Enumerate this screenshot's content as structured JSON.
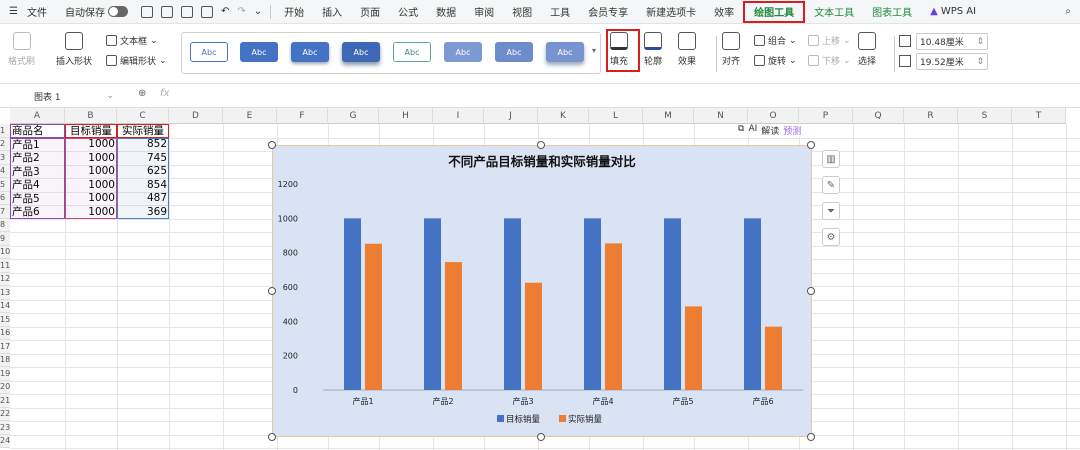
{
  "menubar": {
    "file": "文件",
    "autosave": "自动保存",
    "tabs": [
      "开始",
      "插入",
      "页面",
      "公式",
      "数据",
      "审阅",
      "视图",
      "工具",
      "会员专享",
      "新建选项卡",
      "效率",
      "绘图工具",
      "文本工具",
      "图表工具",
      "WPS AI"
    ]
  },
  "ribbon": {
    "format_brush": "格式刷",
    "insert_shape": "插入形状",
    "text_box": "文本框",
    "edit_shape": "编辑形状",
    "style_label": "Abc",
    "fill": "填充",
    "outline": "轮廓",
    "effects": "效果",
    "align": "对齐",
    "group": "组合",
    "rotate": "旋转",
    "bring_up": "上移",
    "send_down": "下移",
    "select": "选择",
    "width": "10.48厘米",
    "height": "19.52厘米"
  },
  "formulabar": {
    "namebox": "图表 1",
    "fx": "fx"
  },
  "grid": {
    "columns": [
      "A",
      "B",
      "C",
      "D",
      "E",
      "F",
      "G",
      "H",
      "I",
      "J",
      "K",
      "L",
      "M",
      "N",
      "O",
      "P",
      "Q",
      "R",
      "S",
      "T"
    ],
    "rows": [
      "1",
      "2",
      "3",
      "4",
      "5",
      "6",
      "7",
      "8",
      "9",
      "10",
      "11",
      "12",
      "13",
      "14",
      "15",
      "16",
      "17",
      "18",
      "19",
      "20",
      "21",
      "22",
      "23",
      "24"
    ],
    "headers": [
      "商品名",
      "目标销量",
      "实际销量"
    ],
    "data": [
      [
        "产品1",
        "1000",
        "852"
      ],
      [
        "产品2",
        "1000",
        "745"
      ],
      [
        "产品3",
        "1000",
        "625"
      ],
      [
        "产品4",
        "1000",
        "854"
      ],
      [
        "产品5",
        "1000",
        "487"
      ],
      [
        "产品6",
        "1000",
        "369"
      ]
    ]
  },
  "ai_bar": {
    "ai": "AI",
    "explain": "解读",
    "trend": "预测"
  },
  "chart_data": {
    "type": "bar",
    "title": "不同产品目标销量和实际销量对比",
    "categories": [
      "产品1",
      "产品2",
      "产品3",
      "产品4",
      "产品5",
      "产品6"
    ],
    "series": [
      {
        "name": "目标销量",
        "values": [
          1000,
          1000,
          1000,
          1000,
          1000,
          1000
        ],
        "color": "#4472c4"
      },
      {
        "name": "实际销量",
        "values": [
          852,
          745,
          625,
          854,
          487,
          369
        ],
        "color": "#ed7d31"
      }
    ],
    "ylim": [
      0,
      1200
    ],
    "yticks": [
      0,
      200,
      400,
      600,
      800,
      1000,
      1200
    ],
    "legend": "bottom",
    "grid": false
  },
  "colors": {
    "accent": "#1f8a3f",
    "highlight": "#d81e1e",
    "chart_bg": "#dae3f3"
  }
}
